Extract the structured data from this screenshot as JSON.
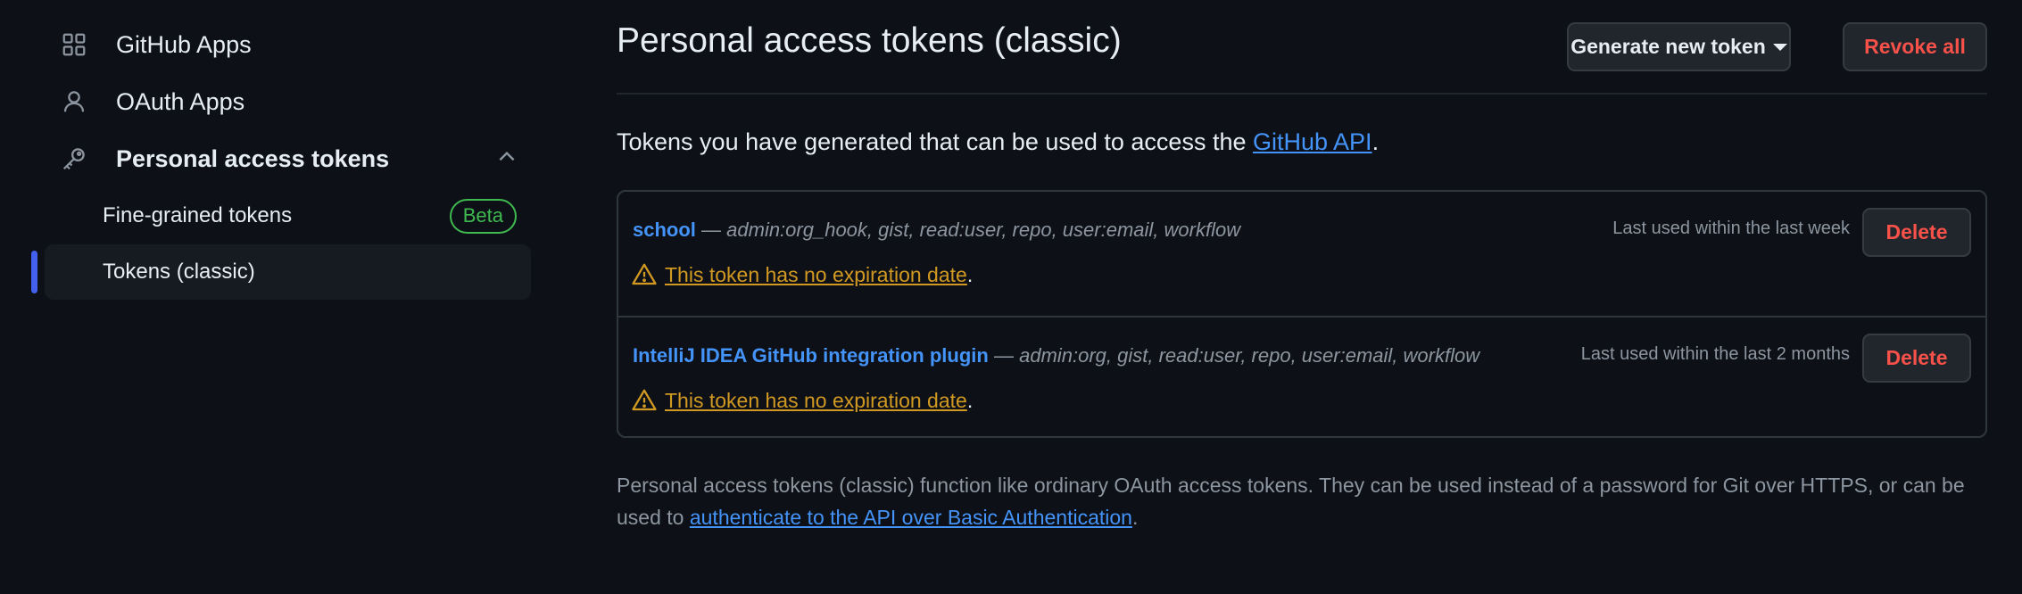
{
  "sidebar": {
    "items": [
      {
        "label": "GitHub Apps",
        "icon": "apps-grid-icon"
      },
      {
        "label": "OAuth Apps",
        "icon": "person-icon"
      },
      {
        "label": "Personal access tokens",
        "icon": "key-icon",
        "expanded": true
      },
      {
        "label": "Fine-grained tokens",
        "badge": "Beta"
      },
      {
        "label": "Tokens (classic)",
        "active": true
      }
    ]
  },
  "header": {
    "title": "Personal access tokens (classic)",
    "generate_label": "Generate new token",
    "revoke_label": "Revoke all"
  },
  "intro": {
    "text_before": "Tokens you have generated that can be used to access the ",
    "link": "GitHub API",
    "text_after": "."
  },
  "tokens": [
    {
      "name": "school",
      "separator": " — ",
      "scopes": "admin:org_hook, gist, read:user, repo, user:email, workflow",
      "last_used": "Last used within the last week",
      "warning": "This token has no expiration date",
      "warning_end": ".",
      "delete_label": "Delete"
    },
    {
      "name": "IntelliJ IDEA GitHub integration plugin",
      "separator": " — ",
      "scopes": "admin:org, gist, read:user, repo, user:email, workflow",
      "last_used": "Last used within the last 2 months",
      "warning": "This token has no expiration date",
      "warning_end": ".",
      "delete_label": "Delete"
    }
  ],
  "footnote": {
    "text_before": "Personal access tokens (classic) function like ordinary OAuth access tokens. They can be used instead of a password for Git over HTTPS, or can be used to ",
    "link": "authenticate to the API over Basic Authentication",
    "text_after": "."
  },
  "colors": {
    "background": "#0d1117",
    "link": "#4493f8",
    "danger": "#f85149",
    "warning": "#d29922",
    "success": "#3fb950",
    "active_indicator": "#4361ee"
  }
}
